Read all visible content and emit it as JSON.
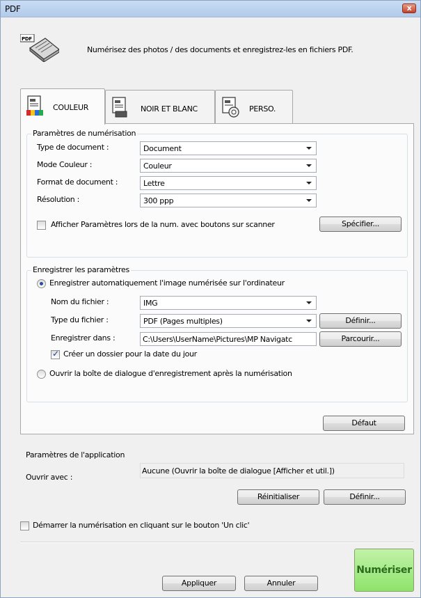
{
  "window": {
    "title": "PDF",
    "close_glyph": "x"
  },
  "header": {
    "description": "Numérisez des photos / des documents et enregistrez-les en fichiers PDF.",
    "icon": "scanner-pdf-icon"
  },
  "tabs": [
    {
      "label": "COULEUR",
      "active": true,
      "icon": "color-document-icon"
    },
    {
      "label": "NOIR ET BLANC",
      "active": false,
      "icon": "bw-document-icon"
    },
    {
      "label": "PERSO.",
      "active": false,
      "icon": "custom-document-icon"
    }
  ],
  "scan_settings": {
    "title": "Paramètres de numérisation",
    "fields": [
      {
        "label": "Type de document :",
        "value": "Document"
      },
      {
        "label": "Mode Couleur :",
        "value": "Couleur"
      },
      {
        "label": "Format de document :",
        "value": "Lettre"
      },
      {
        "label": "Résolution :",
        "value": "300 ppp"
      }
    ],
    "show_settings_label": "Afficher Paramètres lors de la num. avec boutons sur scanner",
    "show_settings_checked": false,
    "specify_button": "Spécifier..."
  },
  "save_settings": {
    "title": "Enregistrer les paramètres",
    "auto_save_label": "Enregistrer automatiquement l'image numérisée sur l'ordinateur",
    "file_name_label": "Nom du fichier :",
    "file_name_value": "IMG",
    "file_type_label": "Type du fichier :",
    "file_type_value": "PDF (Pages multiples)",
    "define_button": "Définir...",
    "save_in_label": "Enregistrer dans :",
    "save_in_value": "C:\\Users\\UserName\\Pictures\\MP Navigatc",
    "browse_button": "Parcourir...",
    "date_folder_label": "Créer un dossier pour la date du jour",
    "date_folder_checked": true,
    "open_dialog_label": "Ouvrir la boîte de dialogue d'enregistrement après la numérisation"
  },
  "default_button": "Défaut",
  "app_settings": {
    "title": "Paramètres de l'application",
    "open_with_label": "Ouvrir avec :",
    "open_with_value": "Aucune (Ouvrir la boîte de dialogue [Afficher et util.])",
    "reset_button": "Réinitialiser",
    "define_button": "Définir..."
  },
  "one_click": {
    "label": "Démarrer la numérisation en cliquant sur le bouton 'Un clic'",
    "checked": false
  },
  "footer": {
    "apply_button": "Appliquer",
    "cancel_button": "Annuler",
    "scan_button": "Numériser"
  },
  "colors": {
    "scan_button_bg": "#8ee36b",
    "scan_button_text": "#2a6a1c",
    "titlebar": "#b2cbea"
  }
}
